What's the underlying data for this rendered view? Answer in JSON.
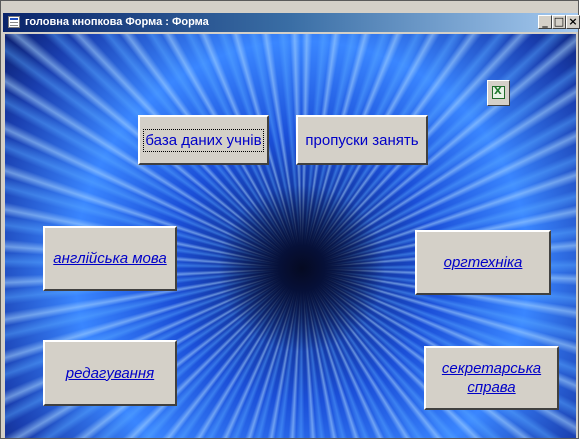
{
  "window": {
    "title": "головна кнопкова Форма : Форма",
    "controls": {
      "minimize": "_",
      "maximize": "□",
      "close": "×"
    }
  },
  "form": {
    "buttons": {
      "students_db": "база даних учнів",
      "absences": "пропуски занять",
      "english": "англійська мова",
      "office_equipment": "оргтехніка",
      "editing": "редагування",
      "secretarial_line1": "секретарська",
      "secretarial_line2": "справа"
    },
    "excel_icon": "excel-icon"
  },
  "colors": {
    "titlebar_start": "#0a246a",
    "titlebar_end": "#a6caf0",
    "button_face": "#d4d0c8",
    "button_text": "#0000c8"
  }
}
